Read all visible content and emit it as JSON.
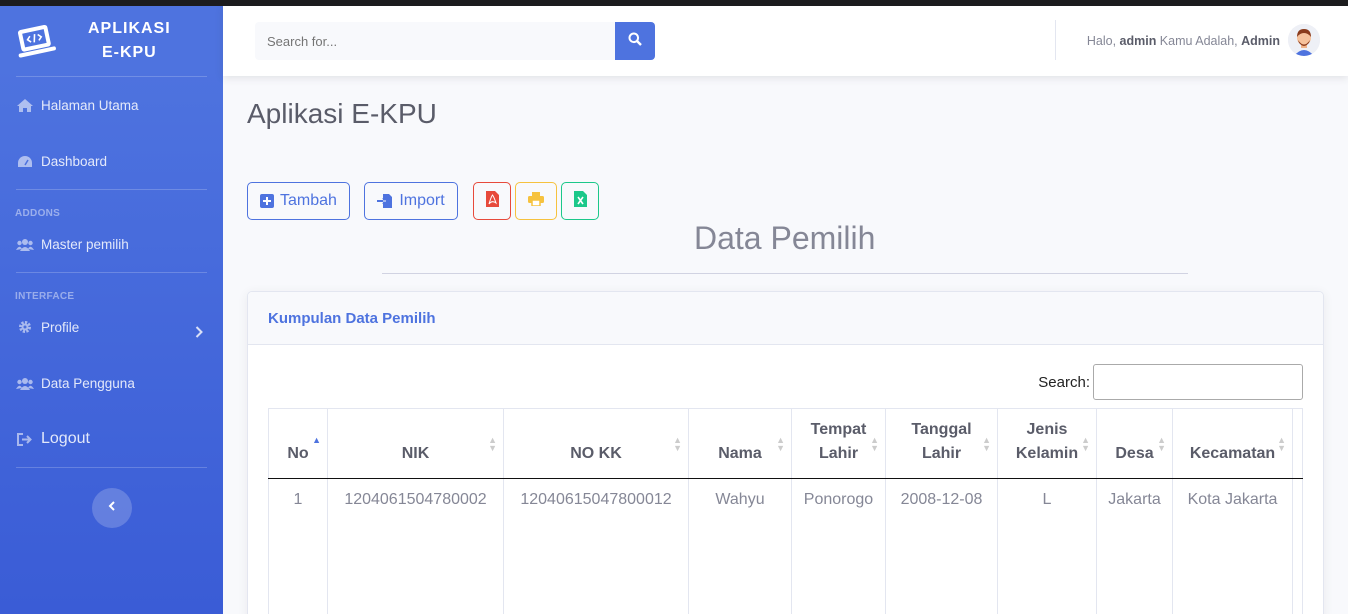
{
  "brand": {
    "line1": "APLIKASI",
    "line2": "E-KPU"
  },
  "sidebar": {
    "items": [
      {
        "label": "Halaman Utama",
        "icon": "home-icon"
      },
      {
        "label": "Dashboard",
        "icon": "tachometer-icon"
      }
    ],
    "addons_heading": "ADDONS",
    "addons": [
      {
        "label": "Master pemilih",
        "icon": "users-icon"
      }
    ],
    "interface_heading": "INTERFACE",
    "interface": [
      {
        "label": "Profile",
        "icon": "cog-icon"
      },
      {
        "label": "Data Pengguna",
        "icon": "users-icon"
      }
    ],
    "logout": "Logout"
  },
  "topbar": {
    "search_placeholder": "Search for...",
    "greeting_prefix": "Halo, ",
    "username": "admin",
    "greeting_mid": " Kamu Adalah, ",
    "role": "Admin"
  },
  "page": {
    "title": "Aplikasi E-KPU",
    "tambah_label": "Tambah",
    "import_label": "Import",
    "data_title": "Data Pemilih"
  },
  "card": {
    "header": "Kumpulan Data Pemilih",
    "search_label": "Search:",
    "columns": [
      {
        "label": "No",
        "sort": "asc"
      },
      {
        "label": "NIK",
        "sort": "both"
      },
      {
        "label": "NO KK",
        "sort": "both"
      },
      {
        "label": "Nama",
        "sort": "both"
      },
      {
        "label": "Tempat Lahir",
        "sort": "both"
      },
      {
        "label": "Tanggal Lahir",
        "sort": "both"
      },
      {
        "label": "Jenis Kelamin",
        "sort": "both"
      },
      {
        "label": "Desa",
        "sort": "both"
      },
      {
        "label": "Kecamatan",
        "sort": "both"
      }
    ],
    "rows": [
      [
        "1",
        "1204061504780002",
        "12040615047800012",
        "Wahyu",
        "Ponorogo",
        "2008-12-08",
        "L",
        "Jakarta",
        "Kota Jakarta"
      ]
    ]
  },
  "colors": {
    "primary": "#4e73df",
    "danger": "#e74a3b",
    "warning": "#f6c23e",
    "success": "#1cc88a"
  }
}
